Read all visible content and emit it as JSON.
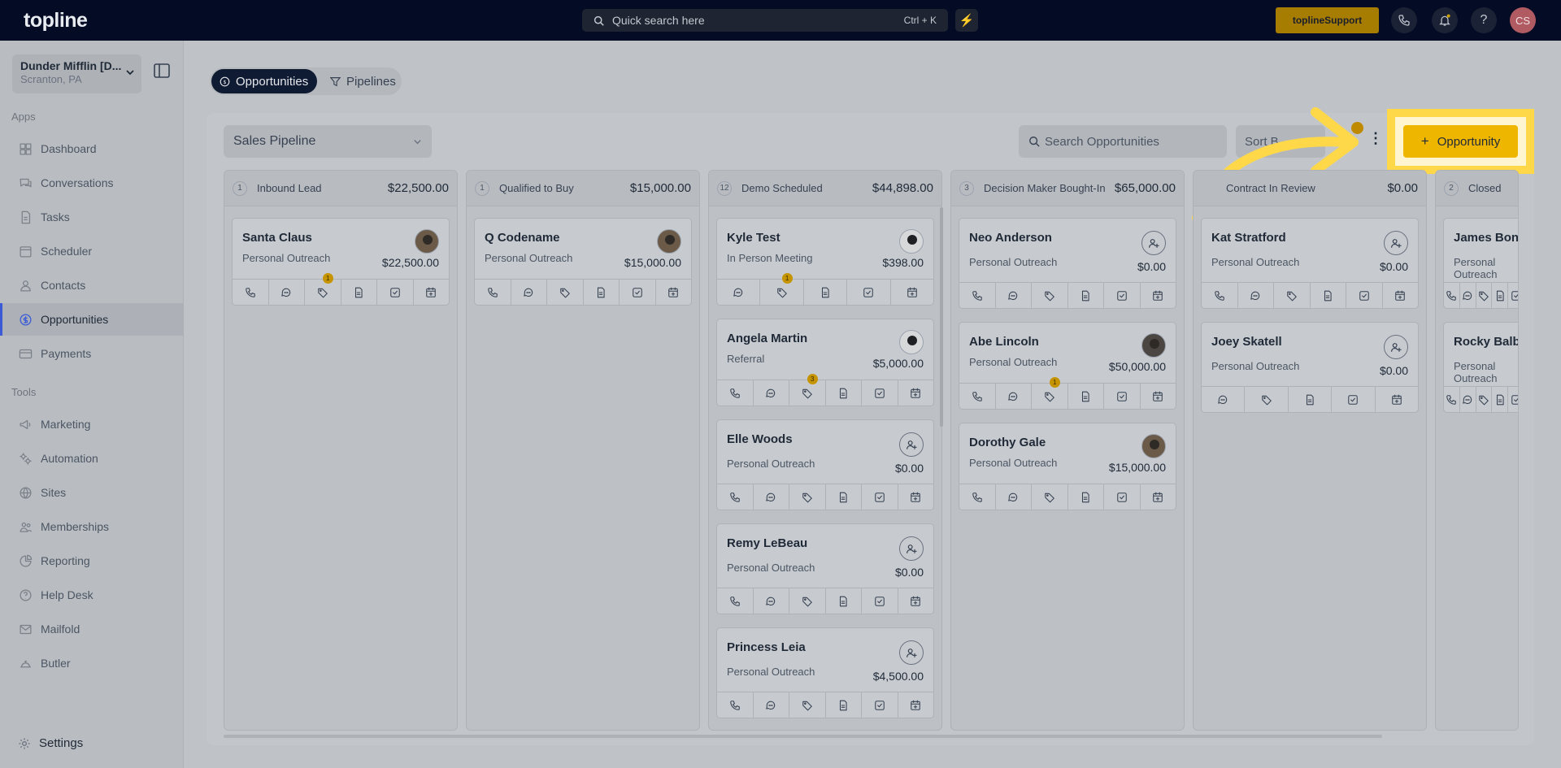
{
  "topbar": {
    "logo": "topline",
    "search_placeholder": "Quick search here",
    "search_shortcut": "Ctrl + K",
    "support_brand": "topline",
    "support_label": " Support",
    "user_initials": "CS"
  },
  "sidebar": {
    "account_name": "Dunder Mifflin [D...",
    "account_location": "Scranton, PA",
    "apps_title": "Apps",
    "apps": [
      {
        "label": "Dashboard",
        "icon": "dashboard-icon"
      },
      {
        "label": "Conversations",
        "icon": "chat-icon"
      },
      {
        "label": "Tasks",
        "icon": "tasks-icon"
      },
      {
        "label": "Scheduler",
        "icon": "calendar-icon"
      },
      {
        "label": "Contacts",
        "icon": "person-icon"
      },
      {
        "label": "Opportunities",
        "icon": "dollar-icon",
        "active": true
      },
      {
        "label": "Payments",
        "icon": "card-icon"
      }
    ],
    "tools_title": "Tools",
    "tools": [
      {
        "label": "Marketing",
        "icon": "megaphone-icon"
      },
      {
        "label": "Automation",
        "icon": "gears-icon"
      },
      {
        "label": "Sites",
        "icon": "globe-icon"
      },
      {
        "label": "Memberships",
        "icon": "members-icon"
      },
      {
        "label": "Reporting",
        "icon": "pie-icon"
      },
      {
        "label": "Help Desk",
        "icon": "help-icon"
      },
      {
        "label": "Mailfold",
        "icon": "mail-icon"
      },
      {
        "label": "Butler",
        "icon": "butler-icon"
      }
    ],
    "settings_label": "Settings"
  },
  "tabs": {
    "opportunities": "Opportunities",
    "pipelines": "Pipelines"
  },
  "toolbar": {
    "pipeline_select": "Sales Pipeline",
    "search_placeholder": "Search Opportunities",
    "sort_label": "Sort B",
    "add_label": "Opportunity"
  },
  "columns": [
    {
      "count": "1",
      "name": "Inbound Lead",
      "total": "$22,500.00",
      "cards": [
        {
          "name": "Santa Claus",
          "source": "Personal Outreach",
          "amount": "$22,500.00",
          "avatar": "photo",
          "actions": [
            "phone",
            "chat",
            "tag",
            "doc",
            "check",
            "cal"
          ],
          "badge": {
            "action": 2,
            "value": "1"
          }
        }
      ]
    },
    {
      "count": "1",
      "name": "Qualified to Buy",
      "total": "$15,000.00",
      "cards": [
        {
          "name": "Q Codename",
          "source": "Personal Outreach",
          "amount": "$15,000.00",
          "avatar": "photo",
          "actions": [
            "phone",
            "chat",
            "tag",
            "doc",
            "check",
            "cal"
          ]
        }
      ]
    },
    {
      "count": "12",
      "name": "Demo Scheduled",
      "total": "$44,898.00",
      "cards": [
        {
          "name": "Kyle Test",
          "source": "In Person Meeting",
          "amount": "$398.00",
          "avatar": "photo3",
          "actions": [
            "chat",
            "tag",
            "doc",
            "check",
            "cal"
          ],
          "badge": {
            "action": 1,
            "value": "1"
          }
        },
        {
          "name": "Angela Martin",
          "source": "Referral",
          "amount": "$5,000.00",
          "avatar": "photo3",
          "actions": [
            "phone",
            "chat",
            "tag",
            "doc",
            "check",
            "cal"
          ],
          "badge": {
            "action": 2,
            "value": "3"
          }
        },
        {
          "name": "Elle Woods",
          "source": "Personal Outreach",
          "amount": "$0.00",
          "avatar": "assign",
          "actions": [
            "phone",
            "chat",
            "tag",
            "doc",
            "check",
            "cal"
          ]
        },
        {
          "name": "Remy LeBeau",
          "source": "Personal Outreach",
          "amount": "$0.00",
          "avatar": "assign",
          "actions": [
            "phone",
            "chat",
            "tag",
            "doc",
            "check",
            "cal"
          ]
        },
        {
          "name": "Princess Leia",
          "source": "Personal Outreach",
          "amount": "$4,500.00",
          "avatar": "assign",
          "actions": [
            "phone",
            "chat",
            "tag",
            "doc",
            "check",
            "cal"
          ]
        }
      ]
    },
    {
      "count": "3",
      "name": "Decision Maker Bought-In",
      "total": "$65,000.00",
      "cards": [
        {
          "name": "Neo Anderson",
          "source": "Personal Outreach",
          "amount": "$0.00",
          "avatar": "assign",
          "actions": [
            "phone",
            "chat",
            "tag",
            "doc",
            "check",
            "cal"
          ]
        },
        {
          "name": "Abe Lincoln",
          "source": "Personal Outreach",
          "amount": "$50,000.00",
          "avatar": "photo2",
          "actions": [
            "phone",
            "chat",
            "tag",
            "doc",
            "check",
            "cal"
          ],
          "badge": {
            "action": 2,
            "value": "1"
          }
        },
        {
          "name": "Dorothy Gale",
          "source": "Personal Outreach",
          "amount": "$15,000.00",
          "avatar": "photo",
          "actions": [
            "phone",
            "chat",
            "tag",
            "doc",
            "check",
            "cal"
          ]
        }
      ]
    },
    {
      "count": "",
      "name": "Contract In Review",
      "total": "$0.00",
      "cards": [
        {
          "name": "Kat Stratford",
          "source": "Personal Outreach",
          "amount": "$0.00",
          "avatar": "assign",
          "actions": [
            "phone",
            "chat",
            "tag",
            "doc",
            "check",
            "cal"
          ]
        },
        {
          "name": "Joey Skatell",
          "source": "Personal Outreach",
          "amount": "$0.00",
          "avatar": "assign",
          "actions": [
            "chat",
            "tag",
            "doc",
            "check",
            "cal"
          ]
        }
      ]
    },
    {
      "count": "2",
      "name": "Closed",
      "total": "",
      "cards": [
        {
          "name": "James Bond",
          "source": "Personal Outreach",
          "amount": "",
          "avatar": "none",
          "actions": [
            "phone",
            "chat",
            "tag",
            "doc",
            "check",
            "cal"
          ]
        },
        {
          "name": "Rocky Balbe",
          "source": "Personal Outreach",
          "amount": "",
          "avatar": "none",
          "actions": [
            "phone",
            "chat",
            "tag",
            "doc",
            "check",
            "cal"
          ]
        }
      ]
    }
  ]
}
